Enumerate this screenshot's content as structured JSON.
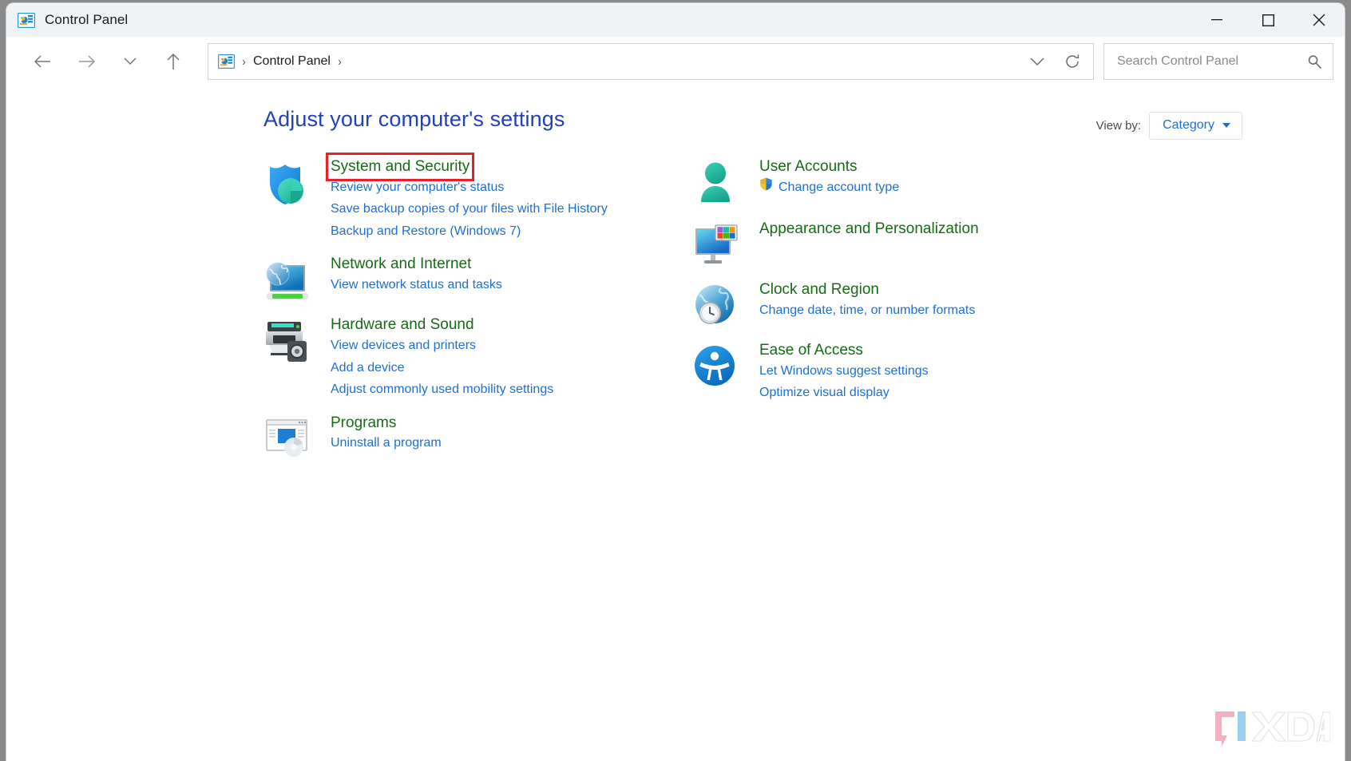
{
  "window": {
    "title": "Control Panel",
    "app_icon": "control-panel-icon",
    "controls": {
      "minimize": "Minimize",
      "maximize": "Maximize",
      "close": "Close"
    }
  },
  "navbar": {
    "back": "Back",
    "forward": "Forward",
    "recent_dropdown": "Recent locations",
    "up": "Up",
    "address": {
      "icon": "control-panel-icon",
      "separator": "›",
      "crumb": "Control Panel",
      "trailing_separator": "›",
      "dropdown": "Previous locations",
      "refresh": "Refresh"
    },
    "search": {
      "placeholder": "Search Control Panel",
      "value": "",
      "icon": "search-icon"
    }
  },
  "main": {
    "title": "Adjust your computer's settings",
    "view_by": {
      "label": "View by:",
      "value": "Category",
      "caret": "chevron-down-icon"
    },
    "left_column": [
      {
        "icon": "shield-icon",
        "title": "System and Security",
        "highlighted": true,
        "links": [
          {
            "text": "Review your computer's status",
            "shield": false
          },
          {
            "text": "Save backup copies of your files with File History",
            "shield": false
          },
          {
            "text": "Backup and Restore (Windows 7)",
            "shield": false
          }
        ]
      },
      {
        "icon": "network-globe-monitor-icon",
        "title": "Network and Internet",
        "highlighted": false,
        "links": [
          {
            "text": "View network status and tasks",
            "shield": false
          }
        ]
      },
      {
        "icon": "printer-speaker-icon",
        "title": "Hardware and Sound",
        "highlighted": false,
        "links": [
          {
            "text": "View devices and printers",
            "shield": false
          },
          {
            "text": "Add a device",
            "shield": false
          },
          {
            "text": "Adjust commonly used mobility settings",
            "shield": false
          }
        ]
      },
      {
        "icon": "programs-window-icon",
        "title": "Programs",
        "highlighted": false,
        "links": [
          {
            "text": "Uninstall a program",
            "shield": false
          }
        ]
      }
    ],
    "right_column": [
      {
        "icon": "user-person-icon",
        "title": "User Accounts",
        "highlighted": false,
        "links": [
          {
            "text": "Change account type",
            "shield": true
          }
        ]
      },
      {
        "icon": "monitor-color-swatches-icon",
        "title": "Appearance and Personalization",
        "highlighted": false,
        "links": []
      },
      {
        "icon": "globe-clock-icon",
        "title": "Clock and Region",
        "highlighted": false,
        "links": [
          {
            "text": "Change date, time, or number formats",
            "shield": false
          }
        ]
      },
      {
        "icon": "accessibility-person-icon",
        "title": "Ease of Access",
        "highlighted": false,
        "links": [
          {
            "text": "Let Windows suggest settings",
            "shield": false
          },
          {
            "text": "Optimize visual display",
            "shield": false
          }
        ]
      }
    ]
  },
  "watermark": {
    "text": "XDA"
  },
  "colors": {
    "titlebar_bg": "#eff3f6",
    "page_title": "#2341b8",
    "category_title": "#186a19",
    "link": "#1f6fd0",
    "highlight_outline": "#e8202a",
    "accent_teal": "#27b3a0"
  }
}
